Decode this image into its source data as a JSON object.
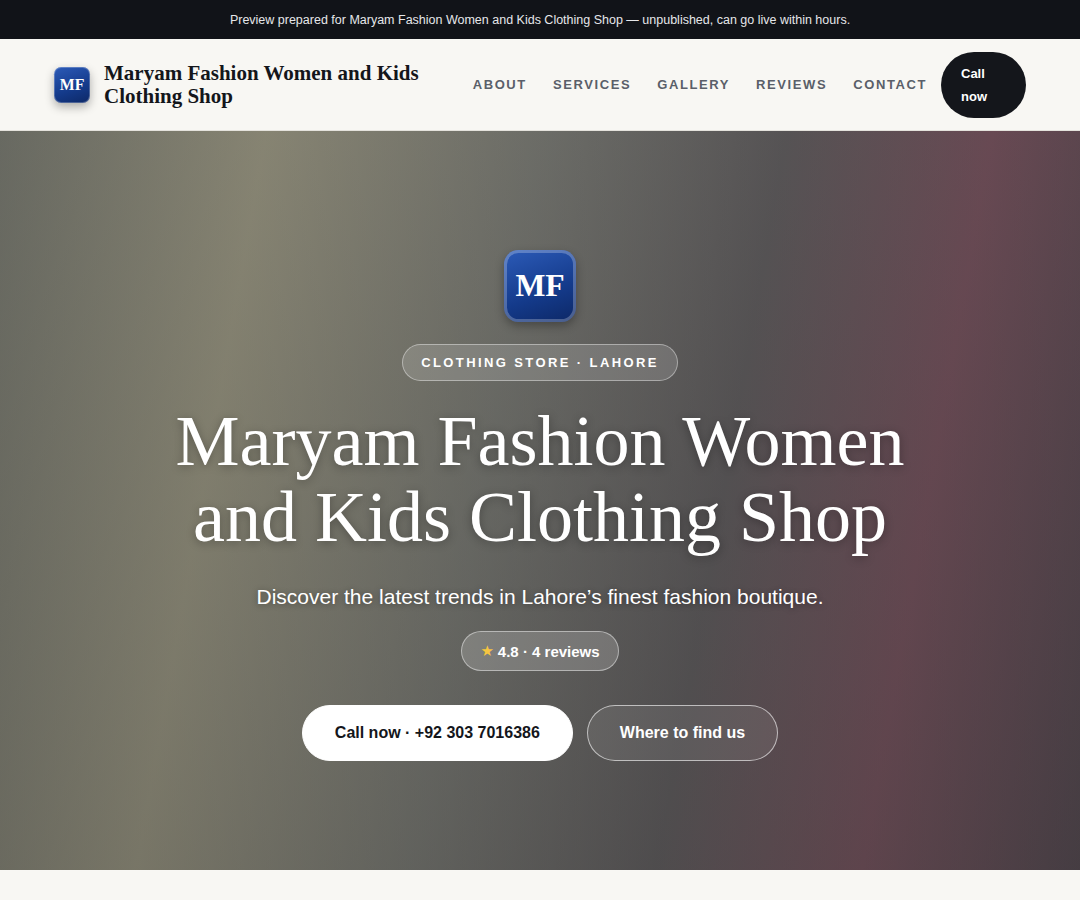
{
  "banner": {
    "text": "Preview prepared for Maryam Fashion Women and Kids Clothing Shop — unpublished, can go live within hours."
  },
  "header": {
    "logo": "MF",
    "name": "Maryam Fashion Women and Kids Clothing Shop",
    "nav": [
      {
        "label": "ABOUT"
      },
      {
        "label": "SERVICES"
      },
      {
        "label": "GALLERY"
      },
      {
        "label": "REVIEWS"
      },
      {
        "label": "CONTACT"
      }
    ],
    "cta": "Call now"
  },
  "hero": {
    "logo": "MF",
    "tag": "CLOTHING STORE · LAHORE",
    "title": "Maryam Fashion Women and Kids Clothing Shop",
    "subtitle": "Discover the latest trends in Lahore’s finest fashion boutique.",
    "rating": {
      "star": "★",
      "text": "4.8 · 4 reviews"
    },
    "buttons": [
      {
        "label": "Call now · +92 303 7016386",
        "kind": "primary"
      },
      {
        "label": "Where to find us",
        "kind": "outline"
      }
    ]
  }
}
